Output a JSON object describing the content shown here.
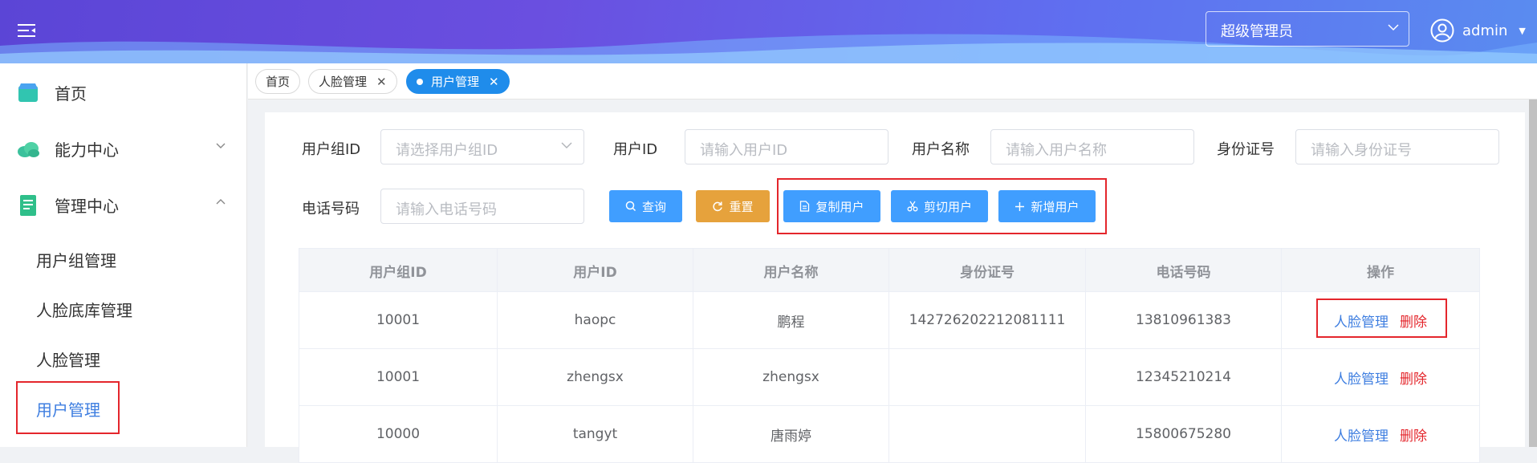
{
  "header": {
    "role_select": "超级管理员",
    "username": "admin"
  },
  "sidebar": {
    "items": [
      {
        "label": "首页"
      },
      {
        "label": "能力中心"
      },
      {
        "label": "管理中心"
      }
    ],
    "sub_items": [
      {
        "label": "用户组管理"
      },
      {
        "label": "人脸底库管理"
      },
      {
        "label": "人脸管理"
      },
      {
        "label": "用户管理"
      }
    ]
  },
  "tabs": [
    {
      "label": "首页"
    },
    {
      "label": "人脸管理"
    },
    {
      "label": "用户管理"
    }
  ],
  "filters": {
    "group_id": {
      "label": "用户组ID",
      "placeholder": "请选择用户组ID"
    },
    "user_id": {
      "label": "用户ID",
      "placeholder": "请输入用户ID"
    },
    "user_name": {
      "label": "用户名称",
      "placeholder": "请输入用户名称"
    },
    "id_card": {
      "label": "身份证号",
      "placeholder": "请输入身份证号"
    },
    "phone": {
      "label": "电话号码",
      "placeholder": "请输入电话号码"
    }
  },
  "buttons": {
    "search": "查询",
    "reset": "重置",
    "copy": "复制用户",
    "cut": "剪切用户",
    "add": "新增用户"
  },
  "table": {
    "columns": [
      "用户组ID",
      "用户ID",
      "用户名称",
      "身份证号",
      "电话号码",
      "操作"
    ],
    "rows": [
      {
        "group_id": "10001",
        "user_id": "haopc",
        "name": "鹏程",
        "id_card": "142726202212081111",
        "phone": "13810961383"
      },
      {
        "group_id": "10001",
        "user_id": "zhengsx",
        "name": "zhengsx",
        "id_card": "",
        "phone": "12345210214"
      },
      {
        "group_id": "10000",
        "user_id": "tangyt",
        "name": "唐雨婷",
        "id_card": "",
        "phone": "15800675280"
      }
    ],
    "action_face": "人脸管理",
    "action_delete": "删除"
  },
  "colors": {
    "accent": "#409eff",
    "warning": "#e6a23c",
    "danger": "#e4262c",
    "highlight_box": "#e4262c"
  }
}
